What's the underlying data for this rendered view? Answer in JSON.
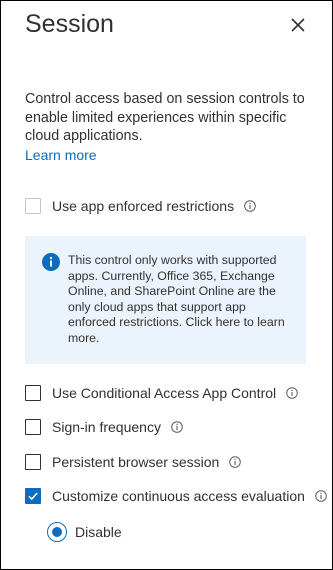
{
  "panel": {
    "title": "Session",
    "description": "Control access based on session controls to enable limited experiences within specific cloud applications.",
    "learn_more": "Learn more"
  },
  "options": {
    "app_enforced": {
      "label": "Use app enforced restrictions",
      "checked": false,
      "disabled": true
    },
    "info_box": "This control only works with supported apps. Currently, Office 365, Exchange Online, and SharePoint Online are the only cloud apps that support app enforced restrictions. Click here to learn more.",
    "app_control": {
      "label": "Use Conditional Access App Control",
      "checked": false
    },
    "signin_frequency": {
      "label": "Sign-in frequency",
      "checked": false
    },
    "persistent_browser": {
      "label": "Persistent browser session",
      "checked": false
    },
    "cae": {
      "label": "Customize continuous access evaluation",
      "checked": true
    },
    "cae_radio": {
      "label": "Disable",
      "selected": true
    }
  },
  "icons": {
    "close": "close-icon",
    "info": "info-icon",
    "checkmark": "checkmark-icon"
  },
  "colors": {
    "accent": "#0f6cbd",
    "info_bg": "#ebf3fc",
    "text": "#323130"
  }
}
